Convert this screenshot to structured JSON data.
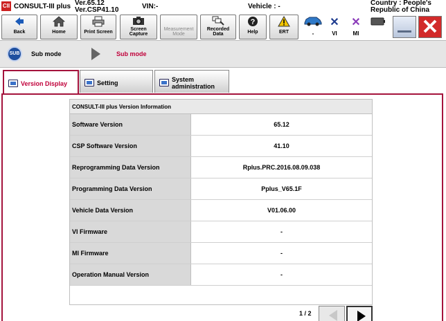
{
  "titlebar": {
    "logo": "CII",
    "app_name": "CONSULT-III plus",
    "version_line1": "Ver.65.12",
    "version_line2": "Ver.CSP41.10",
    "vin_label": "VIN:-",
    "vehicle_label": "Vehicle : -",
    "country_line1": "Country : People's",
    "country_line2": "Republic of China"
  },
  "toolbar": {
    "back": "Back",
    "home": "Home",
    "print_screen": "Print Screen",
    "screen_capture_1": "Screen",
    "screen_capture_2": "Capture",
    "measurement_1": "Measurement",
    "measurement_2": "Mode",
    "recorded_1": "Recorded",
    "recorded_2": "Data",
    "help": "Help",
    "ert": "ERT",
    "vehicle_status": "-",
    "vi_status": "VI",
    "mi_status": "MI"
  },
  "submode": {
    "icon_text": "SUB",
    "label1": "Sub mode",
    "label2": "Sub mode"
  },
  "tabs": {
    "version_display": "Version Display",
    "setting": "Setting",
    "system_admin_1": "System",
    "system_admin_2": "administration"
  },
  "info": {
    "header": "CONSULT-III plus Version Information",
    "rows": [
      {
        "label": "Software Version",
        "value": "65.12"
      },
      {
        "label": "CSP Software Version",
        "value": "41.10"
      },
      {
        "label": "Reprogramming Data Version",
        "value": "Rplus.PRC.2016.08.09.038"
      },
      {
        "label": "Programming Data Version",
        "value": "Pplus_V65.1F"
      },
      {
        "label": "Vehicle Data Version",
        "value": "V01.06.00"
      },
      {
        "label": "VI Firmware",
        "value": "-"
      },
      {
        "label": "MI Firmware",
        "value": "-"
      },
      {
        "label": "Operation Manual Version",
        "value": "-"
      }
    ]
  },
  "pagination": {
    "page_info": "1 / 2"
  },
  "colors": {
    "accent": "#a4123c",
    "sub_icon": "#1e4f9f",
    "mi_color": "#8a3ab9",
    "vi_color": "#1e3c8f",
    "close_btn": "#d22a2a"
  }
}
